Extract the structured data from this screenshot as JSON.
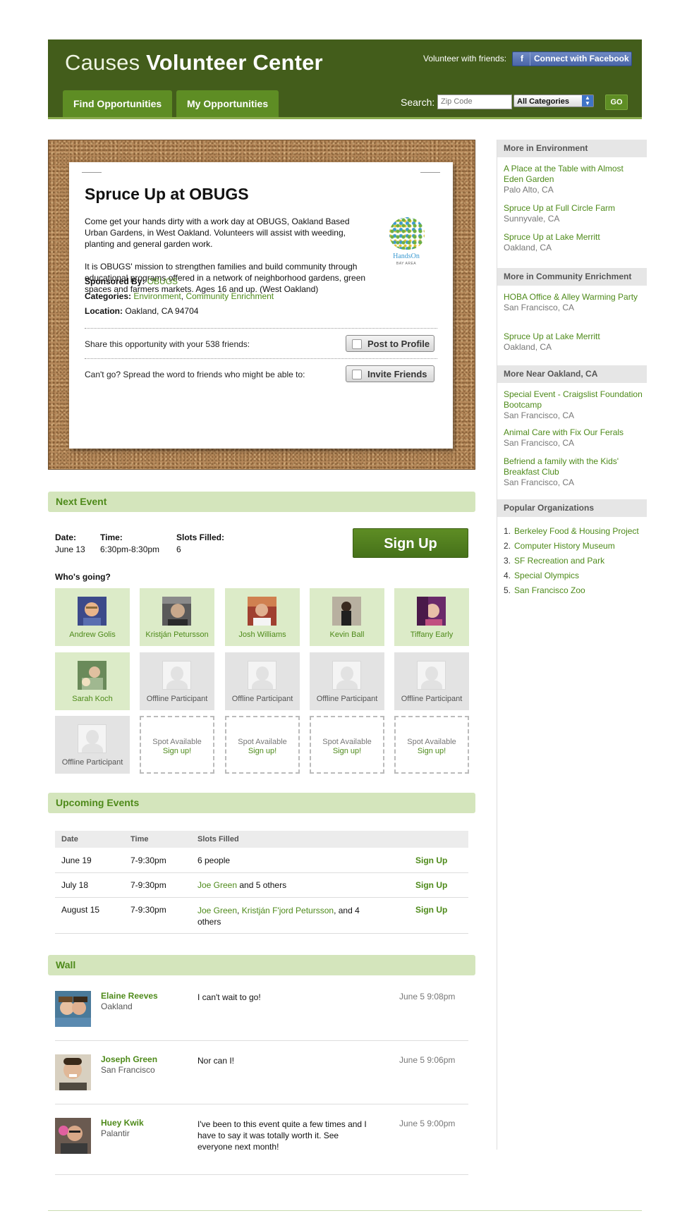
{
  "header": {
    "title_light": "Causes",
    "title_bold": "Volunteer Center",
    "volunteer_label": "Volunteer with friends:",
    "facebook_button": "Connect with Facebook",
    "facebook_icon": "f",
    "tabs": [
      "Find Opportunities",
      "My Opportunities"
    ],
    "search_label": "Search:",
    "zip_placeholder": "Zip Code",
    "category_selected": "All Categories",
    "go_button": "GO"
  },
  "opportunity": {
    "title": "Spruce Up at OBUGS",
    "desc1": "Come get your hands dirty with a work day at OBUGS, Oakland Based Urban Gardens, in West Oakland. Volunteers will assist with weeding, planting and general garden work.",
    "desc2": "It is OBUGS' mission to strengthen families and build community through educational programs offered in a network of neighborhood gardens, green spaces and farmers markets. Ages 16 and up. (West Oakland)",
    "logo_name": "HandsOn",
    "logo_sub": "BAY AREA",
    "sponsored_label": "Sponsored By:",
    "sponsor": "OBUGS",
    "categories_label": "Categories:",
    "category1": "Environment",
    "category_sep": ",",
    "category2": "Community Enrichment",
    "location_label": "Location:",
    "location": "Oakland, CA 94704",
    "share_text": "Share this opportunity with your 538 friends:",
    "post_button": "Post to Profile",
    "invite_text": "Can't go? Spread the word to friends who might be able to:",
    "invite_button": "Invite Friends"
  },
  "next_event": {
    "heading": "Next Event",
    "date_label": "Date:",
    "date": "June 13",
    "time_label": "Time:",
    "time": "6:30pm-8:30pm",
    "slots_label": "Slots Filled:",
    "slots": "6",
    "signup_button": "Sign Up",
    "whos_going": "Who's going?",
    "participants": [
      "Andrew Golis",
      "Kristján Petursson",
      "Josh Williams",
      "Kevin Ball",
      "Tiffany Early",
      "Sarah Koch",
      "Offline Participant",
      "Offline Participant",
      "Offline Participant",
      "Offline Participant",
      "Offline Participant"
    ],
    "spot_text": "Spot Available",
    "spot_link": "Sign up!"
  },
  "upcoming": {
    "heading": "Upcoming Events",
    "columns": [
      "Date",
      "Time",
      "Slots Filled"
    ],
    "rows": [
      {
        "date": "June 19",
        "time": "7-9:30pm",
        "slots": "6 people",
        "action": "Sign Up"
      },
      {
        "date": "July 18",
        "time": "7-9:30pm",
        "slots_link": "Joe Green",
        "slots_rest": " and 5 others",
        "action": "Sign Up"
      },
      {
        "date": "August 15",
        "time": "7-9:30pm",
        "slots_link1": "Joe Green",
        "slots_sep": ", ",
        "slots_link2": "Kristján F'jord Petursson",
        "slots_rest": ", and 4 others",
        "action": "Sign Up"
      }
    ]
  },
  "wall": {
    "heading": "Wall",
    "posts": [
      {
        "name": "Elaine Reeves",
        "location": "Oakland",
        "message": "I can't wait to go!",
        "time": "June 5 9:08pm"
      },
      {
        "name": "Joseph Green",
        "location": "San Francisco",
        "message": "Nor can I!",
        "time": "June 5 9:06pm"
      },
      {
        "name": "Huey Kwik",
        "location": "Palantir",
        "message": "I've been to this event quite a few times and I have to say it was totally worth it. See everyone next month!",
        "time": "June 5 9:00pm"
      }
    ]
  },
  "sidebar": {
    "env_heading": "More in Environment",
    "env_items": [
      {
        "title": "A Place at the Table with Almost Eden Garden",
        "location": "Palo Alto, CA"
      },
      {
        "title": "Spruce Up at Full Circle Farm",
        "location": "Sunnyvale, CA"
      },
      {
        "title": "Spruce Up at Lake Merritt",
        "location": "Oakland, CA"
      }
    ],
    "comm_heading": "More in Community Enrichment",
    "comm_items": [
      {
        "title": "HOBA Office & Alley Warming Party",
        "location": "San Francisco, CA"
      },
      {
        "title": "Spruce Up at Lake Merritt",
        "location": "Oakland, CA"
      }
    ],
    "near_heading": "More Near Oakland, CA",
    "near_items": [
      {
        "title": "Special Event - Craigslist Foundation Bootcamp",
        "location": "San Francisco, CA"
      },
      {
        "title": "Animal Care with Fix Our Ferals",
        "location": "San Francisco, CA"
      },
      {
        "title": "Befriend a family with the Kids' Breakfast Club",
        "location": "San Francisco, CA"
      }
    ],
    "pop_heading": "Popular Organizations",
    "pop_items": [
      {
        "num": "1.",
        "name": "Berkeley Food & Housing Project"
      },
      {
        "num": "2.",
        "name": "Computer History Museum"
      },
      {
        "num": "3.",
        "name": "SF Recreation and Park"
      },
      {
        "num": "4.",
        "name": "Special Olympics"
      },
      {
        "num": "5.",
        "name": "San Francisco Zoo"
      }
    ]
  },
  "colors": {
    "header_bg": "#435d1b",
    "accent_green": "#4e8a1a",
    "section_bg": "#d4e5bc"
  }
}
